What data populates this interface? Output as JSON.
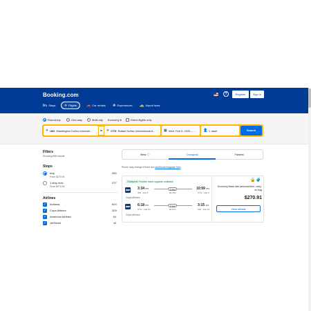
{
  "header": {
    "logo": "Booking.com",
    "help": "?",
    "register": "Register",
    "signin": "Sign in",
    "nav": [
      {
        "icon": "🛏",
        "label": "Stays"
      },
      {
        "icon": "✈",
        "label": "Flights"
      },
      {
        "icon": "🚗",
        "label": "Car rentals"
      },
      {
        "icon": "☸",
        "label": "Experiences"
      },
      {
        "icon": "🚕",
        "label": "Airport taxis"
      }
    ]
  },
  "search": {
    "trip_types": [
      "Round-trip",
      "One-way",
      "Multi-city"
    ],
    "cabin": "Economy ▾",
    "direct_only": "Direct flights only",
    "from_code": "IAD",
    "from_name": "Washington Dulles internati...",
    "swap": "⇆",
    "to_code": "CTG",
    "to_name": "Rafael Núñez International A...",
    "dates": "Wed, Feb 5, 2025 – ...",
    "travelers": "1 adult",
    "search_label": "Search"
  },
  "filters": {
    "title": "Filters",
    "showing": "Showing 835 results",
    "stops_title": "Stops",
    "stops": [
      {
        "label": "Any",
        "price": "From $270.91",
        "count": "330"
      },
      {
        "label": "1 stop max",
        "price": "From $270.91",
        "count": "377"
      }
    ],
    "airlines_title": "Airlines",
    "airlines": [
      {
        "label": "Avianca",
        "count": "624"
      },
      {
        "label": "Copa Airlines",
        "count": "329"
      },
      {
        "label": "American Airlines",
        "count": "61"
      },
      {
        "label": "JetSmart",
        "count": "44"
      }
    ]
  },
  "results": {
    "tabs": [
      "Best",
      "Cheapest",
      "Fastest"
    ],
    "info_icon": "ⓘ",
    "note_prefix": "Prices may change if there are",
    "note_link": "additional baggage fees",
    "card": {
      "badge": "Cheapest",
      "fare_label": "Flexible ticket upgrade available",
      "outbound": {
        "dep": "3:34",
        "dep_ampm": "PM",
        "dep_sub": "IAD · Feb 5",
        "stops": "1 stop",
        "duration": "8h 25m",
        "arr": "10:59",
        "arr_ampm": "PM",
        "arr_sub": "CTG · Feb 5"
      },
      "return": {
        "dep": "6:18",
        "dep_ampm": "PM",
        "dep_sub": "CTG · Feb 13",
        "stops": "1 stop",
        "duration": "8h 57m",
        "arr": "3:15",
        "arr_ampm": "AM",
        "arr_sub": "IAD · Feb 13"
      },
      "airline": "Copa Airlines",
      "price_note": "Economy Basic fare personal item, carry-on bag",
      "price": "$270.91",
      "view_details": "View details"
    }
  }
}
